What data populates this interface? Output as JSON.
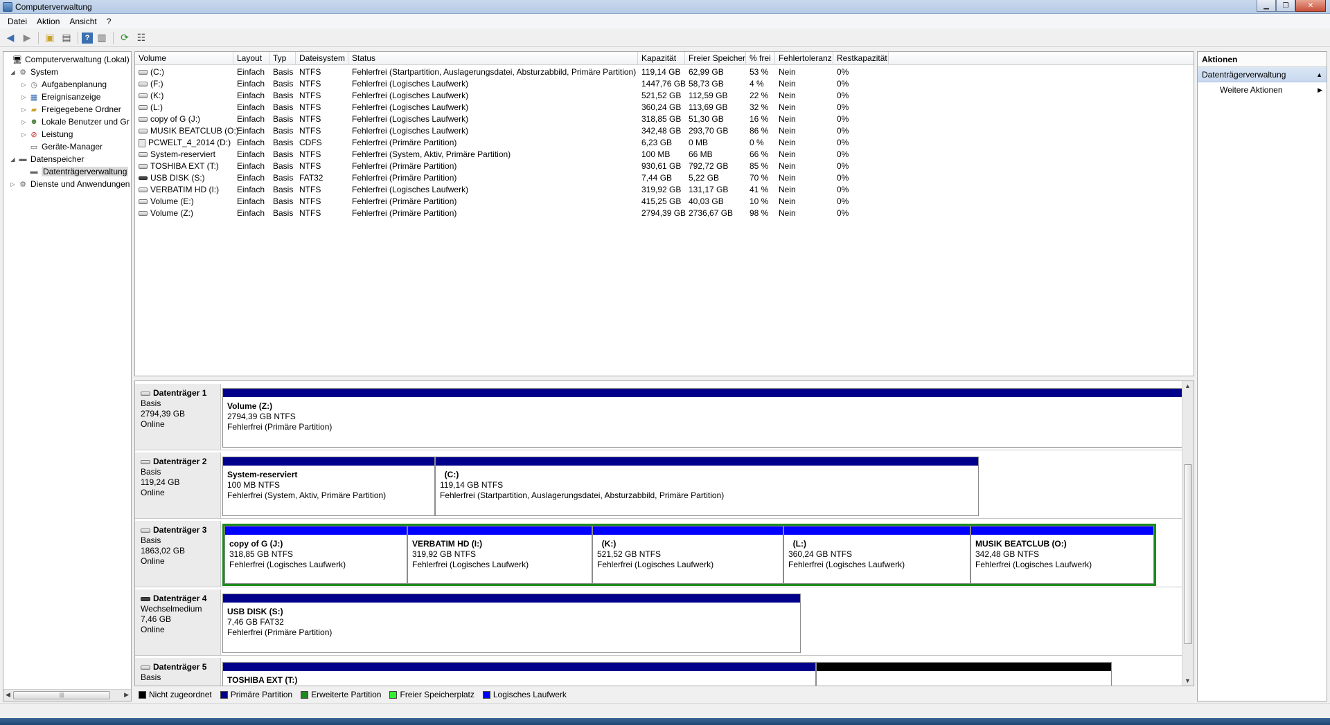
{
  "window": {
    "title": "Computerverwaltung"
  },
  "menu": [
    "Datei",
    "Aktion",
    "Ansicht",
    "?"
  ],
  "tree": [
    {
      "label": "Computerverwaltung (Lokal)",
      "icon": "computer-icon",
      "exp": ""
    },
    {
      "label": "System",
      "icon": "tools-icon",
      "exp": "◢"
    },
    {
      "label": "Aufgabenplanung",
      "icon": "clock-icon",
      "exp": "▷"
    },
    {
      "label": "Ereignisanzeige",
      "icon": "event-viewer-icon",
      "exp": "▷"
    },
    {
      "label": "Freigegebene Ordner",
      "icon": "shared-folder-icon",
      "exp": "▷"
    },
    {
      "label": "Lokale Benutzer und Gr",
      "icon": "users-icon",
      "exp": "▷"
    },
    {
      "label": "Leistung",
      "icon": "performance-icon",
      "exp": "▷"
    },
    {
      "label": "Geräte-Manager",
      "icon": "device-manager-icon",
      "exp": ""
    },
    {
      "label": "Datenspeicher",
      "icon": "storage-icon",
      "exp": "◢"
    },
    {
      "label": "Datenträgerverwaltung",
      "icon": "disk-management-icon",
      "exp": ""
    },
    {
      "label": "Dienste und Anwendungen",
      "icon": "services-icon",
      "exp": "▷"
    }
  ],
  "columns": [
    "Volume",
    "Layout",
    "Typ",
    "Dateisystem",
    "Status",
    "Kapazität",
    "Freier Speicher",
    "% frei",
    "Fehlertoleranz",
    "Restkapazität"
  ],
  "volumes": [
    {
      "icon": "hdd",
      "volume": "(C:)",
      "layout": "Einfach",
      "typ": "Basis",
      "fs": "NTFS",
      "status": "Fehlerfrei (Startpartition, Auslagerungsdatei, Absturzabbild, Primäre Partition)",
      "cap": "119,14 GB",
      "free": "62,99 GB",
      "pct": "53 %",
      "ft": "Nein",
      "rest": "0%"
    },
    {
      "icon": "hdd",
      "volume": "(F:)",
      "layout": "Einfach",
      "typ": "Basis",
      "fs": "NTFS",
      "status": "Fehlerfrei (Logisches Laufwerk)",
      "cap": "1447,76 GB",
      "free": "58,73 GB",
      "pct": "4 %",
      "ft": "Nein",
      "rest": "0%"
    },
    {
      "icon": "hdd",
      "volume": "(K:)",
      "layout": "Einfach",
      "typ": "Basis",
      "fs": "NTFS",
      "status": "Fehlerfrei (Logisches Laufwerk)",
      "cap": "521,52 GB",
      "free": "112,59 GB",
      "pct": "22 %",
      "ft": "Nein",
      "rest": "0%"
    },
    {
      "icon": "hdd",
      "volume": "(L:)",
      "layout": "Einfach",
      "typ": "Basis",
      "fs": "NTFS",
      "status": "Fehlerfrei (Logisches Laufwerk)",
      "cap": "360,24 GB",
      "free": "113,69 GB",
      "pct": "32 %",
      "ft": "Nein",
      "rest": "0%"
    },
    {
      "icon": "hdd",
      "volume": "copy of G (J:)",
      "layout": "Einfach",
      "typ": "Basis",
      "fs": "NTFS",
      "status": "Fehlerfrei (Logisches Laufwerk)",
      "cap": "318,85 GB",
      "free": "51,30 GB",
      "pct": "16 %",
      "ft": "Nein",
      "rest": "0%"
    },
    {
      "icon": "hdd",
      "volume": "MUSIK BEATCLUB (O:)",
      "layout": "Einfach",
      "typ": "Basis",
      "fs": "NTFS",
      "status": "Fehlerfrei (Logisches Laufwerk)",
      "cap": "342,48 GB",
      "free": "293,70 GB",
      "pct": "86 %",
      "ft": "Nein",
      "rest": "0%"
    },
    {
      "icon": "cd",
      "volume": "PCWELT_4_2014 (D:)",
      "layout": "Einfach",
      "typ": "Basis",
      "fs": "CDFS",
      "status": "Fehlerfrei (Primäre Partition)",
      "cap": "6,23 GB",
      "free": "0 MB",
      "pct": "0 %",
      "ft": "Nein",
      "rest": "0%"
    },
    {
      "icon": "hdd",
      "volume": "System-reserviert",
      "layout": "Einfach",
      "typ": "Basis",
      "fs": "NTFS",
      "status": "Fehlerfrei (System, Aktiv, Primäre Partition)",
      "cap": "100 MB",
      "free": "66 MB",
      "pct": "66 %",
      "ft": "Nein",
      "rest": "0%"
    },
    {
      "icon": "hdd",
      "volume": "TOSHIBA EXT (T:)",
      "layout": "Einfach",
      "typ": "Basis",
      "fs": "NTFS",
      "status": "Fehlerfrei (Primäre Partition)",
      "cap": "930,61 GB",
      "free": "792,72 GB",
      "pct": "85 %",
      "ft": "Nein",
      "rest": "0%"
    },
    {
      "icon": "usb",
      "volume": "USB DISK (S:)",
      "layout": "Einfach",
      "typ": "Basis",
      "fs": "FAT32",
      "status": "Fehlerfrei (Primäre Partition)",
      "cap": "7,44 GB",
      "free": "5,22 GB",
      "pct": "70 %",
      "ft": "Nein",
      "rest": "0%"
    },
    {
      "icon": "hdd",
      "volume": "VERBATIM HD (I:)",
      "layout": "Einfach",
      "typ": "Basis",
      "fs": "NTFS",
      "status": "Fehlerfrei (Logisches Laufwerk)",
      "cap": "319,92 GB",
      "free": "131,17 GB",
      "pct": "41 %",
      "ft": "Nein",
      "rest": "0%"
    },
    {
      "icon": "hdd",
      "volume": "Volume (E:)",
      "layout": "Einfach",
      "typ": "Basis",
      "fs": "NTFS",
      "status": "Fehlerfrei (Primäre Partition)",
      "cap": "415,25 GB",
      "free": "40,03 GB",
      "pct": "10 %",
      "ft": "Nein",
      "rest": "0%"
    },
    {
      "icon": "hdd",
      "volume": "Volume (Z:)",
      "layout": "Einfach",
      "typ": "Basis",
      "fs": "NTFS",
      "status": "Fehlerfrei (Primäre Partition)",
      "cap": "2794,39 GB",
      "free": "2736,67 GB",
      "pct": "98 %",
      "ft": "Nein",
      "rest": "0%"
    }
  ],
  "disks": [
    {
      "name": "Datenträger 1",
      "type": "Basis",
      "size": "2794,39 GB",
      "state": "Online",
      "partitions": [
        {
          "name": "Volume  (Z:)",
          "line1": "2794,39 GB NTFS",
          "line2": "Fehlerfrei (Primäre Partition)"
        }
      ]
    },
    {
      "name": "Datenträger 2",
      "type": "Basis",
      "size": "119,24 GB",
      "state": "Online",
      "partitions": [
        {
          "name": "System-reserviert",
          "line1": "100 MB NTFS",
          "line2": "Fehlerfrei (System, Aktiv, Primäre Partition)"
        },
        {
          "name": "  (C:)",
          "line1": "119,14 GB NTFS",
          "line2": "Fehlerfrei (Startpartition, Auslagerungsdatei, Absturzabbild, Primäre Partition)"
        }
      ]
    },
    {
      "name": "Datenträger 3",
      "type": "Basis",
      "size": "1863,02 GB",
      "state": "Online",
      "partitions": [
        {
          "name": "copy of G  (J:)",
          "line1": "318,85 GB NTFS",
          "line2": "Fehlerfrei (Logisches Laufwerk)"
        },
        {
          "name": "VERBATIM HD  (I:)",
          "line1": "319,92 GB NTFS",
          "line2": "Fehlerfrei (Logisches Laufwerk)"
        },
        {
          "name": "  (K:)",
          "line1": "521,52 GB NTFS",
          "line2": "Fehlerfrei (Logisches Laufwerk)"
        },
        {
          "name": "  (L:)",
          "line1": "360,24 GB NTFS",
          "line2": "Fehlerfrei (Logisches Laufwerk)"
        },
        {
          "name": "MUSIK BEATCLUB  (O:)",
          "line1": "342,48 GB NTFS",
          "line2": "Fehlerfrei (Logisches Laufwerk)"
        }
      ]
    },
    {
      "name": "Datenträger 4",
      "type": "Wechselmedium",
      "size": "7,46 GB",
      "state": "Online",
      "partitions": [
        {
          "name": "USB DISK  (S:)",
          "line1": "7,46 GB FAT32",
          "line2": "Fehlerfrei (Primäre Partition)"
        }
      ]
    },
    {
      "name": "Datenträger 5",
      "type": "Basis",
      "size": "",
      "state": "",
      "partitions": [
        {
          "name": "TOSHIBA EXT  (T:)",
          "line1": "",
          "line2": ""
        },
        {
          "name": "",
          "line1": "",
          "line2": ""
        }
      ]
    }
  ],
  "legend": [
    {
      "label": "Nicht zugeordnet",
      "color": "#000000"
    },
    {
      "label": "Primäre Partition",
      "color": "#00008b"
    },
    {
      "label": "Erweiterte Partition",
      "color": "#1e8a1e"
    },
    {
      "label": "Freier Speicherplatz",
      "color": "#33ee33"
    },
    {
      "label": "Logisches Laufwerk",
      "color": "#0000ff"
    }
  ],
  "actions": {
    "header": "Aktionen",
    "section": "Datenträgerverwaltung",
    "items": [
      "Weitere Aktionen"
    ]
  }
}
